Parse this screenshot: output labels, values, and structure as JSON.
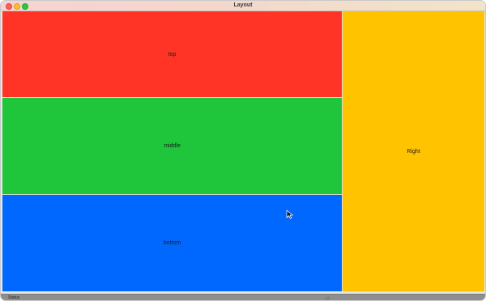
{
  "window": {
    "title": "Layout",
    "traffic_lights": [
      "close",
      "minimize",
      "maximize"
    ]
  },
  "panes": {
    "top": {
      "label": "top",
      "color": "#ff3426"
    },
    "middle": {
      "label": "middle",
      "color": "#1fc53a"
    },
    "bottom": {
      "label": "bottom",
      "color": "#0068ff"
    },
    "right": {
      "label": "Right",
      "color": "#ffc300"
    }
  },
  "statusbar": {
    "label": "Status"
  }
}
